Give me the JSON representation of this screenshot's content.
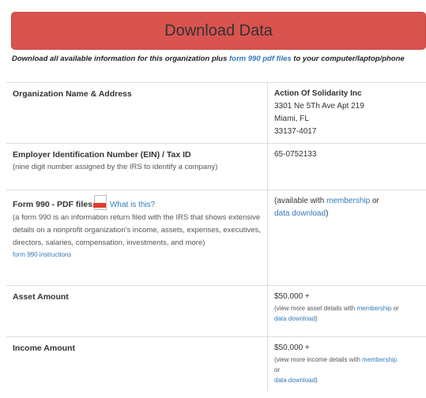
{
  "header": {
    "download_label": "Download Data",
    "description_prefix": "Download all available information for this organization plus ",
    "description_link": "form 990 pdf files",
    "description_suffix": " to your computer/laptop/phone"
  },
  "rows": {
    "org": {
      "label": "Organization Name & Address",
      "name": "Action Of Solidarity Inc",
      "address_line1": "3301 Ne 5Th Ave Apt 219",
      "address_line2": "Miami, FL",
      "address_line3": "33137-4017"
    },
    "ein": {
      "label": "Employer Identification Number (EIN) / Tax ID",
      "note": "(nine digit number assigned by the IRS to identify a company)",
      "value": "65-0752133"
    },
    "form990": {
      "label": "Form 990 - PDF files",
      "help_link": "What is this?",
      "note": "(a form 990 is an information return filed with the IRS that shows extensive details on a nonprofit organization's income, assets, expenses, executives, directors, salaries, compensation, investments, and more)",
      "instructions_link": "form 990 instructions",
      "value_prefix": "(available with ",
      "membership_link": "membership",
      "value_middle": " or ",
      "data_download_link": "data download",
      "value_suffix": ")"
    },
    "asset": {
      "label": "Asset Amount",
      "value": "$50,000 +",
      "note_prefix": "(view more asset details with ",
      "membership_link": "membership",
      "note_middle": " or ",
      "data_download_link": "data download",
      "note_suffix": ")"
    },
    "income": {
      "label": "Income Amount",
      "value": "$50,000 +",
      "note_prefix": "(view more income details with ",
      "membership_link": "membership",
      "note_middle": " or",
      "data_download_link": "data download",
      "note_suffix": ")"
    }
  },
  "colors": {
    "button": "#d9534f",
    "link": "#337ab7",
    "pdf_icon": "#e03a2f"
  },
  "icons": {
    "pdf": "pdf-icon"
  }
}
